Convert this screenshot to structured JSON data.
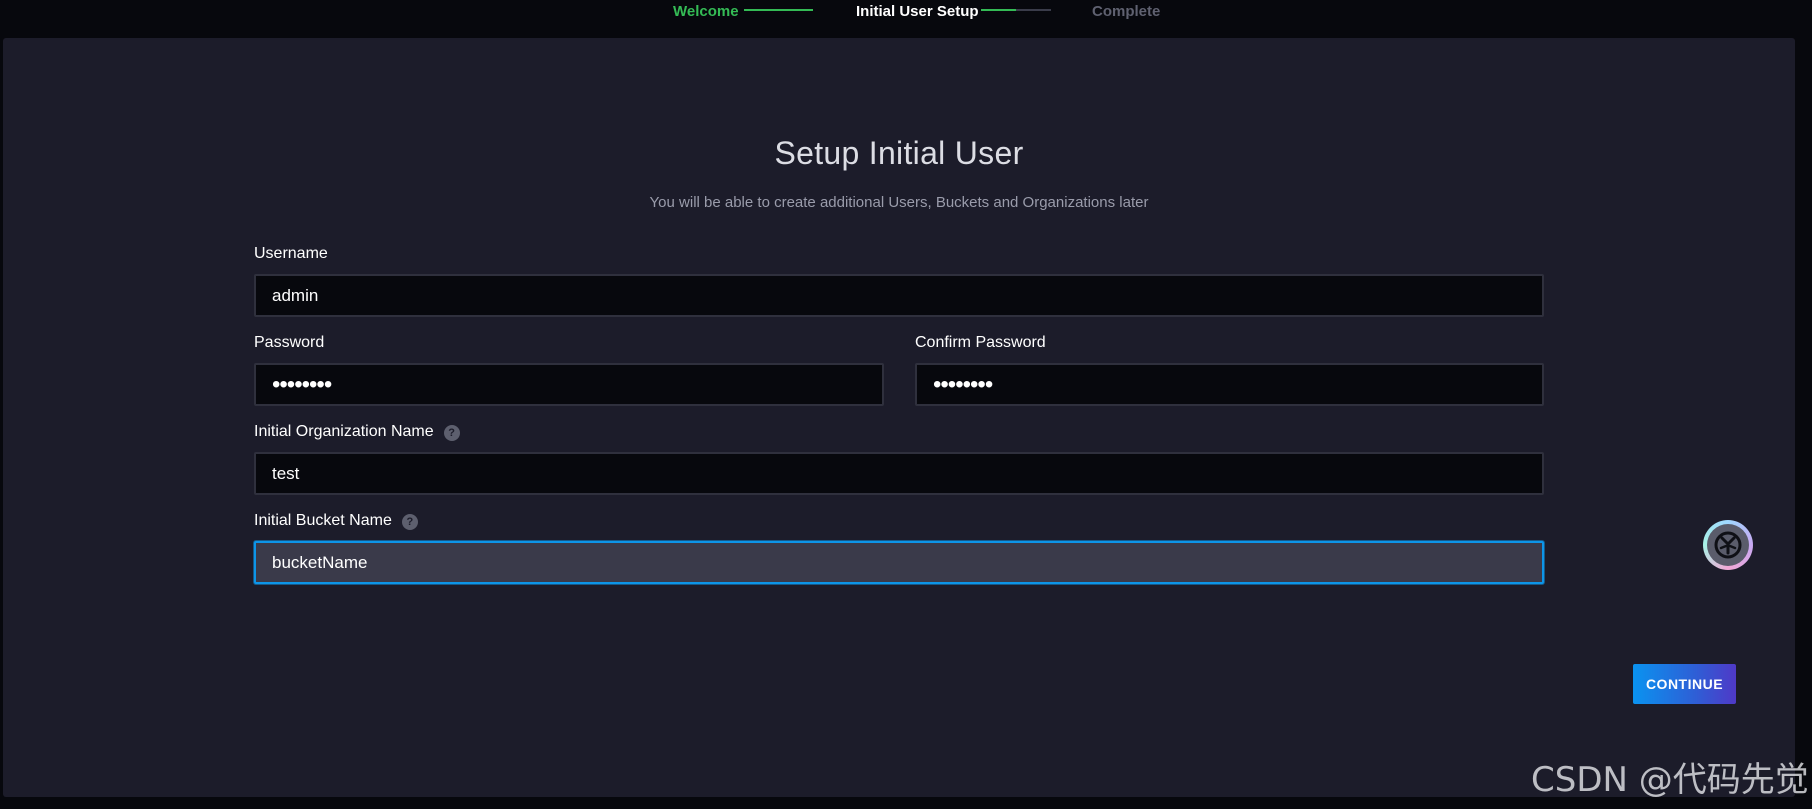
{
  "stepper": {
    "steps": [
      {
        "label": "Welcome",
        "state": "done"
      },
      {
        "label": "Initial User Setup",
        "state": "active"
      },
      {
        "label": "Complete",
        "state": "todo"
      }
    ],
    "progress_after_active": 0.5
  },
  "form": {
    "title": "Setup Initial User",
    "subtitle": "You will be able to create additional Users, Buckets and Organizations later",
    "username_label": "Username",
    "username_value": "admin",
    "password_label": "Password",
    "password_value": "password",
    "confirm_password_label": "Confirm Password",
    "confirm_password_value": "password",
    "org_label": "Initial Organization Name",
    "org_value": "test",
    "bucket_label": "Initial Bucket Name",
    "bucket_value": "bucketName",
    "help_icon": "question-circle-icon",
    "help_glyph": "?"
  },
  "actions": {
    "continue_label": "CONTINUE"
  },
  "watermark": "CSDN @代码先觉",
  "colors": {
    "accent_green": "#34bb55",
    "focus_blue": "#0d95e8",
    "panel_bg": "#1c1c2a",
    "page_bg": "#07080d"
  }
}
